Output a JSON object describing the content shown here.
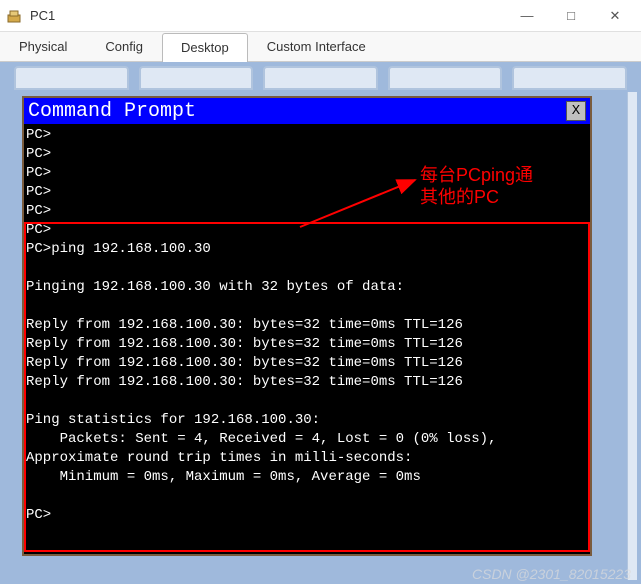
{
  "window": {
    "title": "PC1",
    "controls": {
      "minimize": "—",
      "maximize": "□",
      "close": "✕"
    }
  },
  "tabs": {
    "items": [
      "Physical",
      "Config",
      "Desktop",
      "Custom Interface"
    ],
    "active": 2
  },
  "cmd": {
    "title": "Command Prompt",
    "close": "X",
    "lines": [
      "PC>",
      "PC>",
      "PC>",
      "PC>",
      "PC>",
      "PC>",
      "PC>ping 192.168.100.30",
      "",
      "Pinging 192.168.100.30 with 32 bytes of data:",
      "",
      "Reply from 192.168.100.30: bytes=32 time=0ms TTL=126",
      "Reply from 192.168.100.30: bytes=32 time=0ms TTL=126",
      "Reply from 192.168.100.30: bytes=32 time=0ms TTL=126",
      "Reply from 192.168.100.30: bytes=32 time=0ms TTL=126",
      "",
      "Ping statistics for 192.168.100.30:",
      "    Packets: Sent = 4, Received = 4, Lost = 0 (0% loss),",
      "Approximate round trip times in milli-seconds:",
      "    Minimum = 0ms, Maximum = 0ms, Average = 0ms",
      "",
      "PC>"
    ]
  },
  "annotation": {
    "line1": "每台PCping通",
    "line2": "其他的PC"
  },
  "watermark": "CSDN @2301_82015223"
}
